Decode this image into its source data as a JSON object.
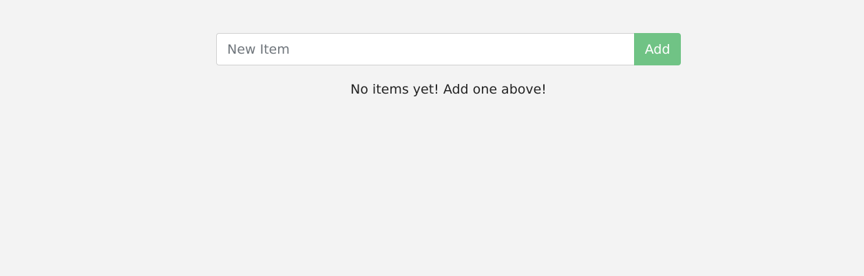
{
  "form": {
    "input_value": "",
    "input_placeholder": "New Item",
    "add_label": "Add"
  },
  "list": {
    "empty_message": "No items yet! Add one above!",
    "items": []
  },
  "colors": {
    "background": "#f3f3f3",
    "add_button": "#70c385",
    "input_border": "#d0d0d0"
  }
}
